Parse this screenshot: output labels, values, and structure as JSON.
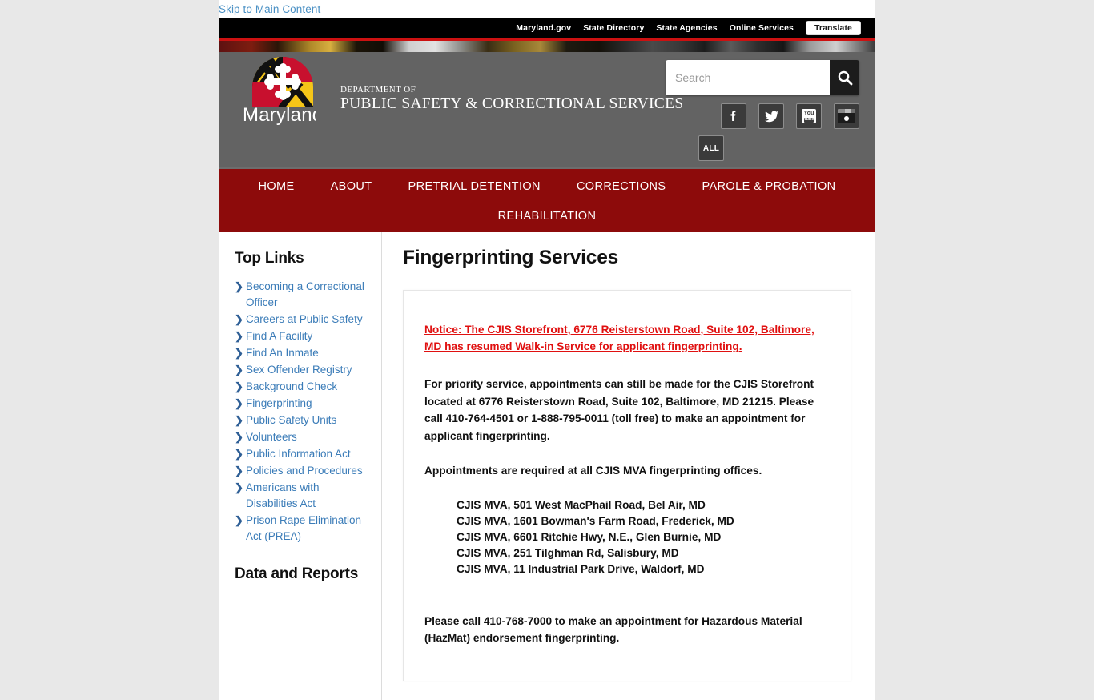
{
  "skip": {
    "label": "Skip to Main Content"
  },
  "state_bar": {
    "links": [
      "Maryland.gov",
      "State Directory",
      "State Agencies",
      "Online Services"
    ],
    "translate_label": "Translate"
  },
  "brand": {
    "wordmark": "Maryland",
    "dept_small": "DEPARTMENT OF",
    "dept_big": "PUBLIC SAFETY & CORRECTIONAL SERVICES",
    "logo_icon": "maryland-flag-shield-icon",
    "colors": {
      "flag_yellow": "#f5c518",
      "flag_black": "#111111",
      "flag_red": "#c8102e",
      "flag_white": "#ffffff"
    }
  },
  "search": {
    "placeholder": "Search",
    "value": "",
    "button_icon": "search-icon"
  },
  "social": {
    "items": [
      {
        "name": "facebook-icon",
        "glyph": "f"
      },
      {
        "name": "twitter-icon",
        "glyph": "ᵛ"
      },
      {
        "name": "youtube-icon",
        "glyph": "You"
      },
      {
        "name": "flickr-icon",
        "glyph": ""
      }
    ],
    "all_label": "ALL",
    "youtube_top": "You",
    "youtube_bottom": "Tube"
  },
  "nav": {
    "primary": [
      "HOME",
      "ABOUT",
      "PRETRIAL DETENTION",
      "CORRECTIONS",
      "PAROLE & PROBATION"
    ],
    "secondary": [
      "REHABILITATION"
    ],
    "bar_color": "#8d0b0b"
  },
  "sidebar": {
    "top_links_heading": "Top Links",
    "top_links": [
      "Becoming a Correctional Officer",
      "Careers at Public Safety",
      "Find A Facility",
      "Find An Inmate",
      "Sex Offender Registry",
      "Background Check",
      "Fingerprinting",
      "Public Safety Units",
      "Volunteers",
      "Public Information Act",
      "Policies and Procedures",
      "Americans with Disabilities Act",
      "Prison Rape Elimination Act (PREA)"
    ],
    "data_reports_heading": "Data and Reports"
  },
  "main": {
    "title": "Fingerprinting Services",
    "notice": "Notice: The CJIS Storefront, 6776 Reisterstown Road, Suite 102, Baltimore, MD has resumed Walk-in Service for applicant fingerprinting.",
    "paragraph_1": "For priority service, appointments can still be made for the CJIS Storefront located at 6776 Reisterstown Road, Suite 102, Baltimore, MD 21215. Please call 410-764-4501 or 1-888-795-0011 (toll free) to make an appointment for applicant fingerprinting.",
    "paragraph_2": "Appointments are required at all CJIS MVA fingerprinting offices.",
    "offices": [
      "CJIS MVA, 501 West MacPhail Road, Bel Air, MD",
      "CJIS MVA, 1601 Bowman's Farm Road, Frederick, MD",
      "CJIS MVA, 6601 Ritchie Hwy, N.E., Glen Burnie, MD",
      "CJIS MVA, 251 Tilghman Rd, Salisbury, MD",
      "CJIS MVA, 11 Industrial Park Drive, Waldorf, MD"
    ],
    "paragraph_3": "Please call 410-768-7000 to make an appointment for Hazardous Material (HazMat) endorsement fingerprinting."
  }
}
